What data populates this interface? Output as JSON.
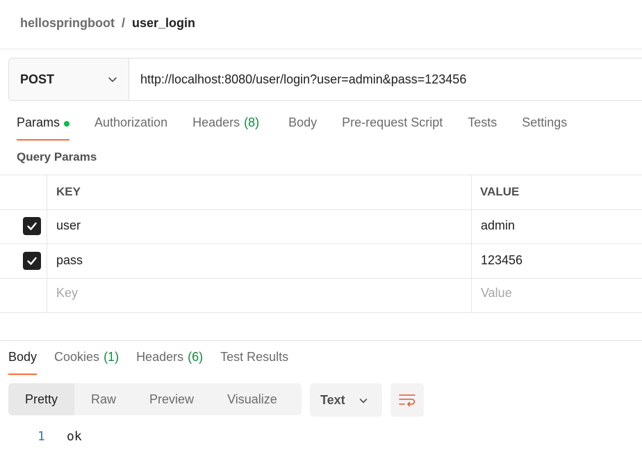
{
  "breadcrumb": {
    "parent": "hellospringboot",
    "separator": "/",
    "current": "user_login"
  },
  "request": {
    "method": "POST",
    "url": "http://localhost:8080/user/login?user=admin&pass=123456"
  },
  "request_tabs": [
    {
      "label": "Params",
      "active": true
    },
    {
      "label": "Authorization"
    },
    {
      "label": "Headers",
      "count": "(8)"
    },
    {
      "label": "Body"
    },
    {
      "label": "Pre-request Script"
    },
    {
      "label": "Tests"
    },
    {
      "label": "Settings"
    }
  ],
  "query_params": {
    "title": "Query Params",
    "headers": {
      "key": "KEY",
      "value": "VALUE"
    },
    "rows": [
      {
        "checked": true,
        "key": "user",
        "value": "admin"
      },
      {
        "checked": true,
        "key": "pass",
        "value": "123456"
      }
    ],
    "placeholder": {
      "key": "Key",
      "value": "Value"
    }
  },
  "response": {
    "tabs": [
      {
        "label": "Body",
        "active": true
      },
      {
        "label": "Cookies",
        "count": "(1)"
      },
      {
        "label": "Headers",
        "count": "(6)"
      },
      {
        "label": "Test Results"
      }
    ],
    "view_modes": [
      "Pretty",
      "Raw",
      "Preview",
      "Visualize"
    ],
    "active_view": "Pretty",
    "format": "Text",
    "lines": [
      {
        "number": "1",
        "text": "ok"
      }
    ]
  },
  "colors": {
    "accent": "#ff6c37",
    "success": "#0cbb52",
    "count_green": "#0f8a3e",
    "line_number": "#3a72b8",
    "wrap_icon": "#e05b2c"
  },
  "icons": {
    "method_dropdown": "chevron-down-icon",
    "format_dropdown": "chevron-down-icon",
    "checkbox": "check-icon",
    "wrap": "word-wrap-icon"
  }
}
